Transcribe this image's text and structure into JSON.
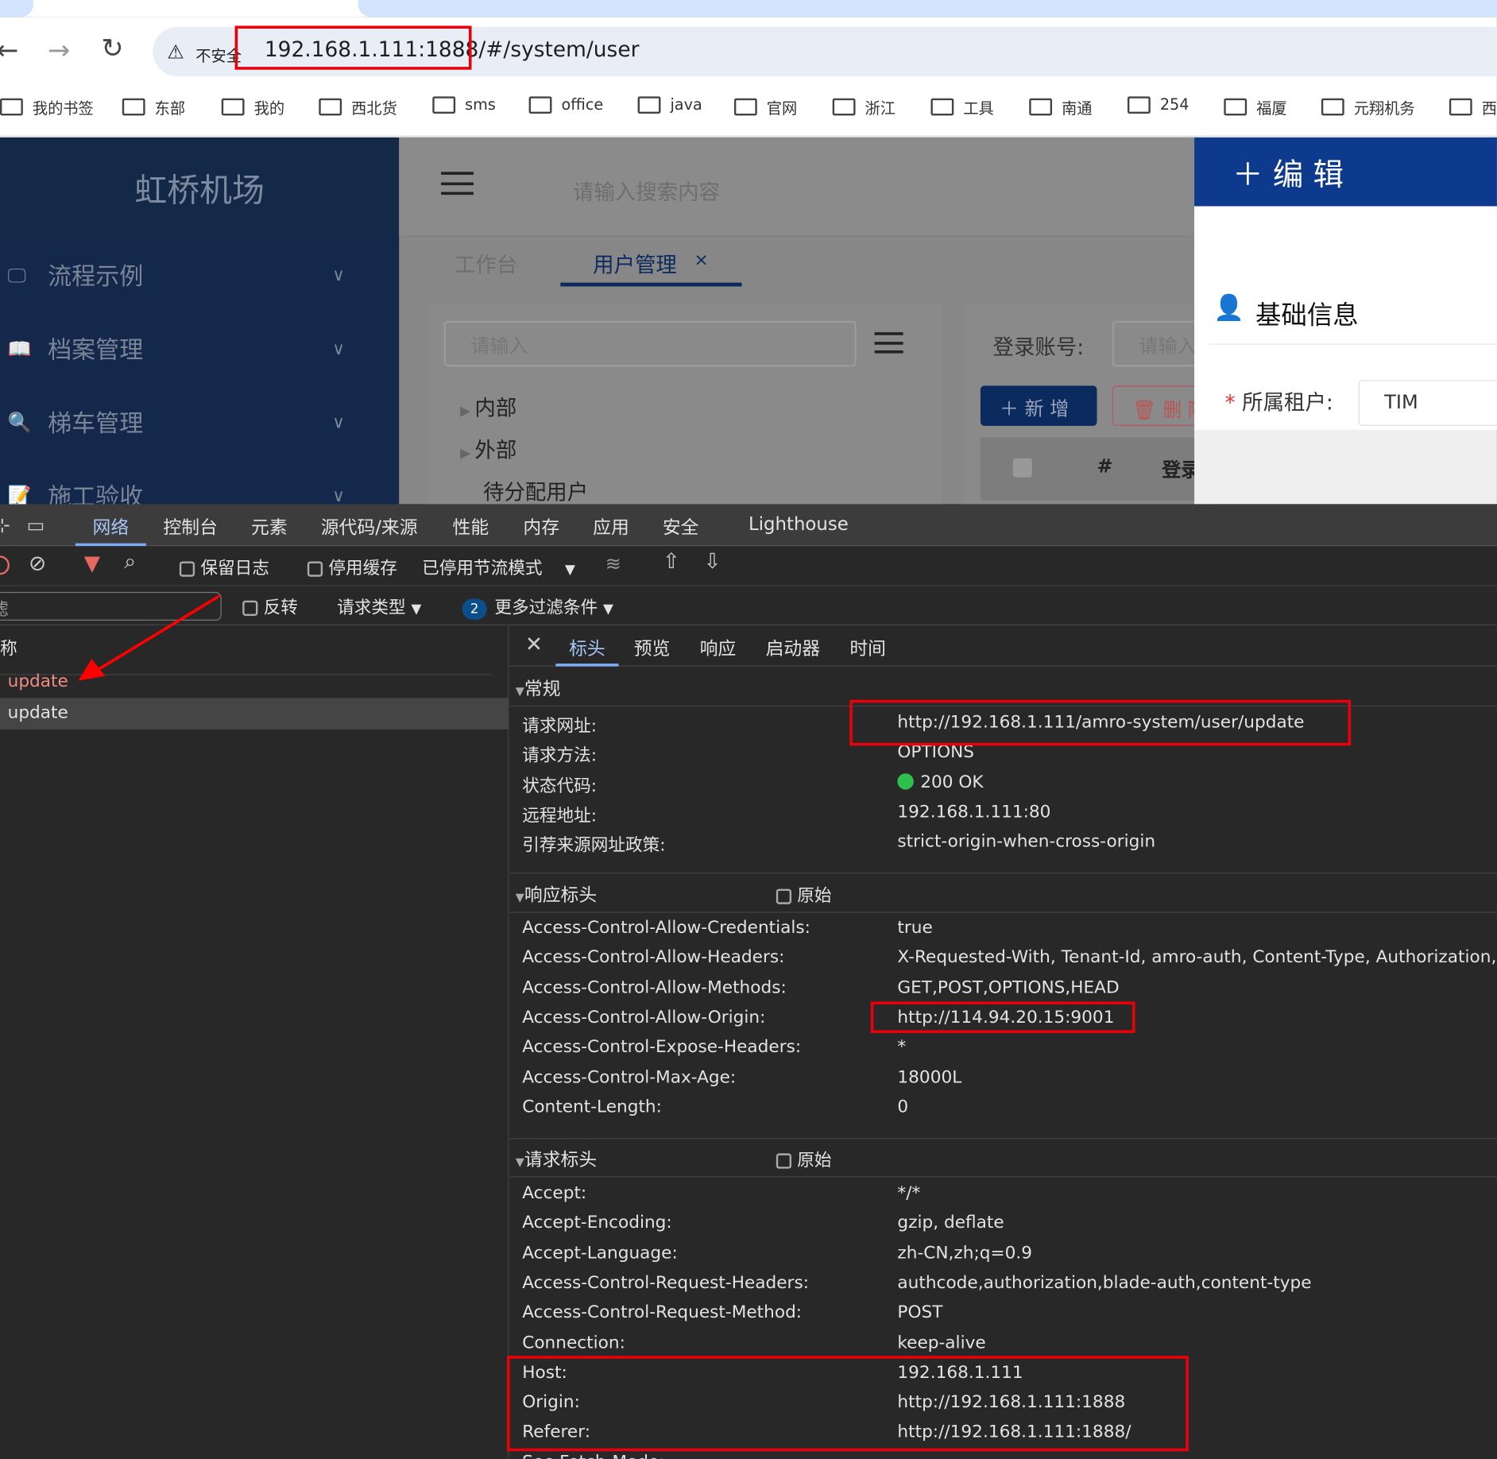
{
  "browser": {
    "security_label": "不安全",
    "url": "192.168.1.111:1888/#/system/user",
    "bookmarks": [
      "我的书签",
      "东部",
      "我的",
      "西北货",
      "sms",
      "office",
      "java",
      "官网",
      "浙江",
      "工具",
      "南通",
      "254",
      "福厦",
      "元翔机务",
      "西"
    ]
  },
  "app": {
    "title": "虹桥机场",
    "search_placeholder": "请输入搜索内容",
    "menu": [
      "流程示例",
      "档案管理",
      "梯车管理",
      "施工验收"
    ],
    "tabs": [
      "工作台",
      "用户管理"
    ],
    "tree_search_placeholder": "请输入",
    "tree": [
      "内部",
      "外部",
      "待分配用户"
    ],
    "login_label": "登录账号:",
    "login_placeholder": "请输入",
    "add_button": "新 增",
    "delete_button": "删 除",
    "table_headers": [
      "#",
      "登录"
    ],
    "drawer": {
      "title": "编 辑",
      "section": "基础信息",
      "tenant_label": "所属租户:",
      "tenant_value": "TIM",
      "accent": "#0d3a8c"
    }
  },
  "devtools": {
    "tabs": [
      "网络",
      "控制台",
      "元素",
      "源代码/来源",
      "性能",
      "内存",
      "应用",
      "安全",
      "Lighthouse"
    ],
    "active_tab": "网络",
    "toolbar": {
      "preserve_log": "保留日志",
      "disable_cache": "停用缓存",
      "throttling": "已停用节流模式"
    },
    "filter": {
      "placeholder": "过滤",
      "invert": "反转",
      "request_types": "请求类型",
      "more_filters_count": "2",
      "more_filters": "更多过滤条件"
    },
    "list_header": "名称",
    "requests": [
      {
        "name": "update",
        "status": "error"
      },
      {
        "name": "update",
        "status": "ok"
      }
    ],
    "detail_tabs": [
      "标头",
      "预览",
      "响应",
      "启动器",
      "时间"
    ],
    "general": {
      "title": "常规",
      "rows": [
        [
          "请求网址:",
          "http://192.168.1.111/amro-system/user/update"
        ],
        [
          "请求方法:",
          "OPTIONS"
        ],
        [
          "状态代码:",
          "200 OK"
        ],
        [
          "远程地址:",
          "192.168.1.111:80"
        ],
        [
          "引荐来源网址政策:",
          "strict-origin-when-cross-origin"
        ]
      ]
    },
    "raw_label": "原始",
    "response_headers": {
      "title": "响应标头",
      "rows": [
        [
          "Access-Control-Allow-Credentials:",
          "true"
        ],
        [
          "Access-Control-Allow-Headers:",
          "X-Requested-With, Tenant-Id, amro-auth, Content-Type, Authorization, crede"
        ],
        [
          "Access-Control-Allow-Methods:",
          "GET,POST,OPTIONS,HEAD"
        ],
        [
          "Access-Control-Allow-Origin:",
          "http://114.94.20.15:9001"
        ],
        [
          "Access-Control-Expose-Headers:",
          "*"
        ],
        [
          "Access-Control-Max-Age:",
          "18000L"
        ],
        [
          "Content-Length:",
          "0"
        ]
      ]
    },
    "request_headers": {
      "title": "请求标头",
      "rows": [
        [
          "Accept:",
          "*/*"
        ],
        [
          "Accept-Encoding:",
          "gzip, deflate"
        ],
        [
          "Accept-Language:",
          "zh-CN,zh;q=0.9"
        ],
        [
          "Access-Control-Request-Headers:",
          "authcode,authorization,blade-auth,content-type"
        ],
        [
          "Access-Control-Request-Method:",
          "POST"
        ],
        [
          "Connection:",
          "keep-alive"
        ],
        [
          "Host:",
          "192.168.1.111"
        ],
        [
          "Origin:",
          "http://192.168.1.111:1888"
        ],
        [
          "Referer:",
          "http://192.168.1.111:1888/"
        ],
        [
          "Sec-Fetch-Mode:",
          ""
        ]
      ]
    },
    "status_color": "#2fbf4f"
  }
}
